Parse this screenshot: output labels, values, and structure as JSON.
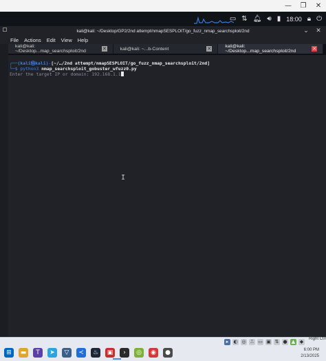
{
  "window": {
    "title": "kali@kali: ~/Desktop/GP2/2nd attempt/nmapSESPLOIT/go_fuzz_nmap_searchsploit/2nd"
  },
  "panel": {
    "clock": "18:00"
  },
  "menu": [
    "File",
    "Actions",
    "Edit",
    "View",
    "Help"
  ],
  "tabs": [
    {
      "label": "kali@kali: ~/Desktop...map_searchsploit/2nd",
      "active": false
    },
    {
      "label": "kali@kali: ~...b-Content",
      "active": false
    },
    {
      "label": "kali@kali: ~/Desktop...map_searchsploit/2nd",
      "active": true
    }
  ],
  "terminal": {
    "prompt_user": "(kali㉿kali)",
    "prompt_path": "[~/…/2nd attempt/nmapSESPLOIT/go_fuzz_nmap_searchsploit/2nd]",
    "prompt_corner_top": "┌──",
    "prompt_corner_bottom": "└─$ ",
    "command": "python3 ",
    "command_arg": "nmap_searchsploit_gobuster_wfuzz0.py",
    "output_line": "Enter the target IP or domain: 192.168.1.1"
  },
  "taskbar": {
    "time": "6:00 PM",
    "date": "2/13/2025",
    "tray_label": "Right Ctrl"
  },
  "colors": {
    "terminal_bg": "#202228",
    "prompt_blue": "#3b82f6",
    "active_tab_close": "#e04444"
  }
}
